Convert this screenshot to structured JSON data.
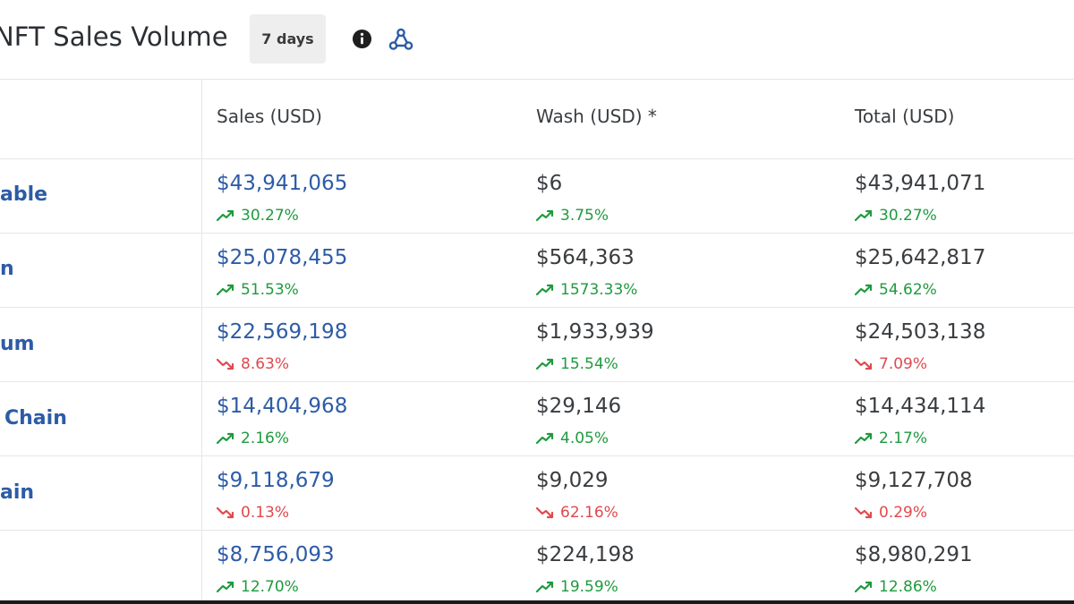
{
  "header": {
    "title": "NFT Sales Volume",
    "period": "7 days",
    "info_icon": "info-icon",
    "webhook_icon": "webhook-icon",
    "accent_color": "#2d5ba6"
  },
  "columns": [
    "Sales (USD)",
    "Wash (USD) *",
    "Total (USD)"
  ],
  "colors": {
    "up": "#1f9a3e",
    "down": "#e0494d",
    "link": "#2d5ba6"
  },
  "rows": [
    {
      "chain": "able",
      "sales": {
        "value": "$43,941,065",
        "change": "30.27%",
        "trend": "up"
      },
      "wash": {
        "value": "$6",
        "change": "3.75%",
        "trend": "up"
      },
      "total": {
        "value": "$43,941,071",
        "change": "30.27%",
        "trend": "up"
      }
    },
    {
      "chain": "n",
      "sales": {
        "value": "$25,078,455",
        "change": "51.53%",
        "trend": "up"
      },
      "wash": {
        "value": "$564,363",
        "change": "1573.33%",
        "trend": "up"
      },
      "total": {
        "value": "$25,642,817",
        "change": "54.62%",
        "trend": "up"
      }
    },
    {
      "chain": "um",
      "sales": {
        "value": "$22,569,198",
        "change": "8.63%",
        "trend": "down"
      },
      "wash": {
        "value": "$1,933,939",
        "change": "15.54%",
        "trend": "up"
      },
      "total": {
        "value": "$24,503,138",
        "change": "7.09%",
        "trend": "down"
      }
    },
    {
      "chain": "Chain",
      "sales": {
        "value": "$14,404,968",
        "change": "2.16%",
        "trend": "up"
      },
      "wash": {
        "value": "$29,146",
        "change": "4.05%",
        "trend": "up"
      },
      "total": {
        "value": "$14,434,114",
        "change": "2.17%",
        "trend": "up"
      }
    },
    {
      "chain": "ain",
      "sales": {
        "value": "$9,118,679",
        "change": "0.13%",
        "trend": "down"
      },
      "wash": {
        "value": "$9,029",
        "change": "62.16%",
        "trend": "down"
      },
      "total": {
        "value": "$9,127,708",
        "change": "0.29%",
        "trend": "down"
      }
    },
    {
      "chain": "",
      "sales": {
        "value": "$8,756,093",
        "change": "12.70%",
        "trend": "up"
      },
      "wash": {
        "value": "$224,198",
        "change": "19.59%",
        "trend": "up"
      },
      "total": {
        "value": "$8,980,291",
        "change": "12.86%",
        "trend": "up"
      }
    }
  ]
}
